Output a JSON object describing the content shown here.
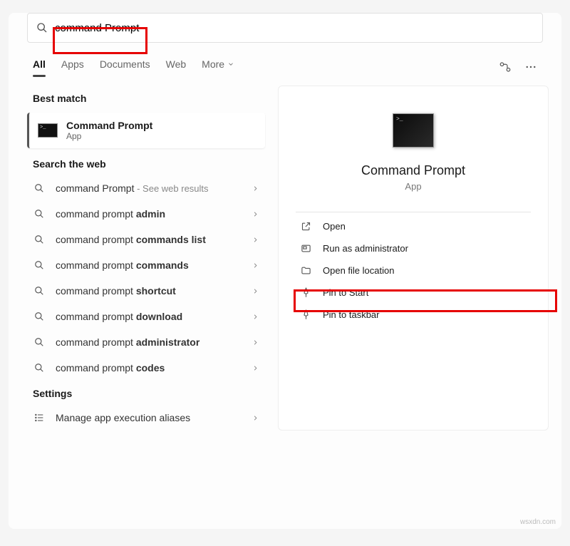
{
  "search": {
    "value": "command Prompt"
  },
  "tabs": {
    "all": "All",
    "apps": "Apps",
    "documents": "Documents",
    "web": "Web",
    "more": "More"
  },
  "sections": {
    "best": "Best match",
    "web": "Search the web",
    "settings": "Settings"
  },
  "bestMatch": {
    "title": "Command Prompt",
    "sub": "App"
  },
  "webResults": {
    "r0": {
      "prefix": "command Prompt",
      "suffix": " - See web results"
    },
    "r1": {
      "prefix": "command prompt ",
      "bold": "admin"
    },
    "r2": {
      "prefix": "command prompt ",
      "bold": "commands list"
    },
    "r3": {
      "prefix": "command prompt ",
      "bold": "commands"
    },
    "r4": {
      "prefix": "command prompt ",
      "bold": "shortcut"
    },
    "r5": {
      "prefix": "command prompt ",
      "bold": "download"
    },
    "r6": {
      "prefix": "command prompt ",
      "bold": "administrator"
    },
    "r7": {
      "prefix": "command prompt ",
      "bold": "codes"
    }
  },
  "settingsItems": {
    "s0": "Manage app execution aliases"
  },
  "preview": {
    "title": "Command Prompt",
    "sub": "App"
  },
  "actions": {
    "open": "Open",
    "runas": "Run as administrator",
    "location": "Open file location",
    "pinstart": "Pin to Start",
    "pintask": "Pin to taskbar"
  },
  "watermark": "wsxdn.com"
}
